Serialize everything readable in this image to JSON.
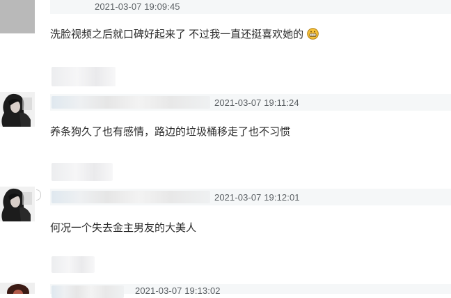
{
  "comments": [
    {
      "timestamp": "2021-03-07 19:09:45",
      "text": "洗脸视频之后就口碑好起来了 不过我一直还挺喜欢她的",
      "emoji_icon": "grinning-face-icon"
    },
    {
      "timestamp": "2021-03-07 19:11:24",
      "text": "养条狗久了也有感情，路边的垃圾桶移走了也不习惯"
    },
    {
      "timestamp": "2021-03-07 19:12:01",
      "text": "何况一个失去金主男友的大美人"
    },
    {
      "timestamp": "2021-03-07 19:13:02"
    }
  ],
  "colors": {
    "background": "#ffffff",
    "meta_band": "#f5f7f8",
    "timestamp_text": "#5a5f63",
    "comment_text": "#2b2b2b"
  }
}
